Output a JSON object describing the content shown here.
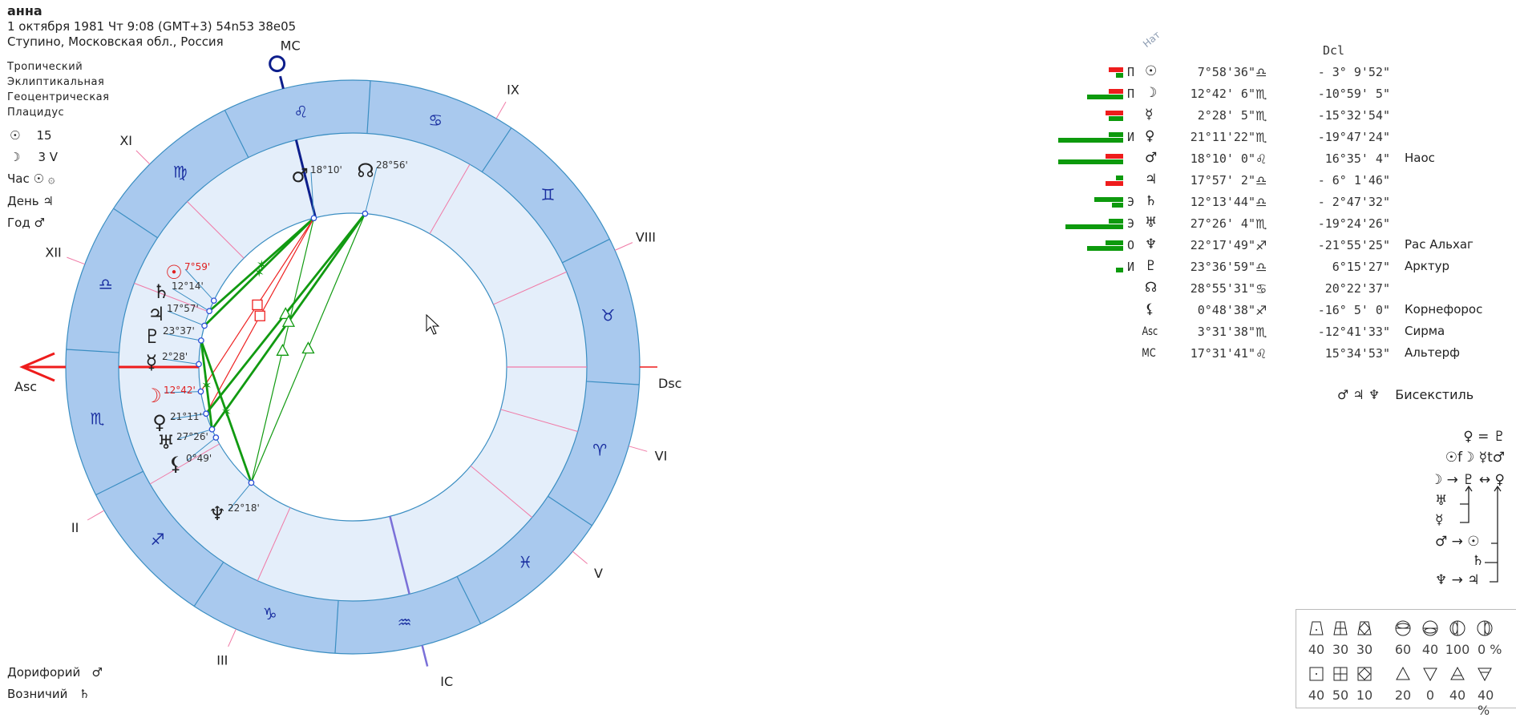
{
  "header": {
    "name": "анна",
    "datetime": "1 октября 1981  Чт   9:08 (GMT+3) 54n53  38e05",
    "place": "Ступино, Московская обл., Россия"
  },
  "settings": [
    "Тропический",
    "Эклиптикальная",
    "Геоцентрическая",
    "Плацидус"
  ],
  "left_info": {
    "sun_day": {
      "glyph": "☉",
      "value": "15"
    },
    "moon_day": {
      "glyph": "☽",
      "value": "3 V"
    },
    "hour": {
      "label": "Час",
      "glyph": "☉ ۞"
    },
    "day": {
      "label": "День",
      "glyph": "♃"
    },
    "year": {
      "label": "Год",
      "glyph": "♂"
    },
    "doryphory": {
      "label": "Дорифорий",
      "glyph": "♂"
    },
    "charioteer": {
      "label": "Возничий",
      "glyph": "♄"
    }
  },
  "wheel": {
    "asc_longitude": 213.527,
    "mc_longitude": 137.528,
    "labels": {
      "mc": "MC",
      "asc": "Asc",
      "dsc": "Dsc",
      "ic": "IC"
    },
    "colors": {
      "band": "#a9c9ee",
      "inner": "#e4eefa",
      "ring": "#3b8ec2",
      "sign": "#1a2fa0",
      "cusp": "#f07aa6",
      "asc": "#ee1c1c",
      "mc": "#0d1e8c",
      "ic": "#7a70d8",
      "marker": "#2a4fd6",
      "sextile": "#119a11",
      "trine": "#119a11",
      "square": "#ee2222"
    },
    "signs": [
      "♈",
      "♉",
      "♊",
      "♋",
      "♌",
      "♍",
      "♎",
      "♏",
      "♐",
      "♑",
      "♒",
      "♓"
    ],
    "houses": [
      {
        "label": "VIII",
        "angle_deg": 24
      },
      {
        "label": "IX",
        "angle_deg": 60
      },
      {
        "label": "XI",
        "angle_deg": 135
      },
      {
        "label": "XII",
        "angle_deg": 159
      },
      {
        "label": "II",
        "angle_deg": 210
      },
      {
        "label": "III",
        "angle_deg": 246
      },
      {
        "label": "V",
        "angle_deg": 320
      },
      {
        "label": "VI",
        "angle_deg": 344
      }
    ],
    "planets": [
      {
        "id": "sun",
        "glyph": "☉",
        "lon": 187.977,
        "label": "7°59'",
        "color": "#e02020"
      },
      {
        "id": "saturn",
        "glyph": "♄",
        "lon": 192.229,
        "label": "12°14'",
        "color": "#222"
      },
      {
        "id": "jupiter",
        "glyph": "♃",
        "lon": 197.951,
        "label": "17°57'",
        "color": "#222"
      },
      {
        "id": "pluto",
        "glyph": "♇",
        "lon": 203.616,
        "label": "23°37'",
        "color": "#222"
      },
      {
        "id": "mercury",
        "glyph": "☿",
        "lon": 212.468,
        "label": "2°28'",
        "color": "#222"
      },
      {
        "id": "moon",
        "glyph": "☽",
        "lon": 222.702,
        "label": "12°42'",
        "color": "#e02020"
      },
      {
        "id": "venus",
        "glyph": "♀",
        "lon": 231.189,
        "label": "21°11'",
        "color": "#222"
      },
      {
        "id": "uranus",
        "glyph": "♅",
        "lon": 237.434,
        "label": "27°26'",
        "color": "#222"
      },
      {
        "id": "lilith",
        "glyph": "⚸",
        "lon": 240.81,
        "label": "0°49'",
        "color": "#222"
      },
      {
        "id": "neptune",
        "glyph": "♆",
        "lon": 262.297,
        "label": "22°18'",
        "color": "#222"
      },
      {
        "id": "mars",
        "glyph": "♂",
        "lon": 138.167,
        "label": "18°10'",
        "color": "#222"
      },
      {
        "id": "node",
        "glyph": "☊",
        "lon": 118.925,
        "label": "28°56'",
        "color": "#222"
      }
    ],
    "aspects": [
      [
        "mars",
        "jupiter",
        "sextile"
      ],
      [
        "mars",
        "saturn",
        "sextile"
      ],
      [
        "mars",
        "moon",
        "square"
      ],
      [
        "mars",
        "venus",
        "square"
      ],
      [
        "mars",
        "neptune",
        "trine"
      ],
      [
        "node",
        "venus",
        "trine"
      ],
      [
        "node",
        "uranus",
        "trine"
      ],
      [
        "node",
        "neptune",
        "trine"
      ],
      [
        "pluto",
        "neptune",
        "sextile"
      ],
      [
        "pluto",
        "uranus",
        "sextile"
      ]
    ]
  },
  "table": {
    "column_nat": "Нат",
    "column_dcl": "Dcl",
    "rows": [
      {
        "bars": {
          "top": {
            "color": "red",
            "value": 18
          },
          "bottom": {
            "color": "green",
            "value": 9
          }
        },
        "status": "П",
        "glyph": "☉",
        "lon": "7°58'36\"",
        "sign": "♎",
        "dcl": "- 3° 9'52\"",
        "star": ""
      },
      {
        "bars": {
          "top": {
            "color": "red",
            "value": 18
          },
          "bottom": {
            "color": "green",
            "value": 45
          }
        },
        "status": "П",
        "glyph": "☽",
        "lon": "12°42' 6\"",
        "sign": "♏",
        "dcl": "-10°59' 5\"",
        "star": ""
      },
      {
        "bars": {
          "top": {
            "color": "red",
            "value": 22
          },
          "bottom": {
            "color": "green",
            "value": 18
          }
        },
        "status": "",
        "glyph": "☿",
        "lon": "2°28' 5\"",
        "sign": "♏",
        "dcl": "-15°32'54\"",
        "star": ""
      },
      {
        "bars": {
          "top": {
            "color": "green",
            "value": 18
          },
          "bottom": {
            "color": "green",
            "value": 81
          }
        },
        "status": "И",
        "glyph": "♀",
        "lon": "21°11'22\"",
        "sign": "♏",
        "dcl": "-19°47'24\"",
        "star": ""
      },
      {
        "bars": {
          "top": {
            "color": "red",
            "value": 22
          },
          "bottom": {
            "color": "green",
            "value": 81
          }
        },
        "status": "",
        "glyph": "♂",
        "lon": "18°10' 0\"",
        "sign": "♌",
        "dcl": "16°35' 4\"",
        "star": "Наос"
      },
      {
        "bars": {
          "top": {
            "color": "green",
            "value": 9
          },
          "bottom": {
            "color": "red",
            "value": 22
          }
        },
        "status": "",
        "glyph": "♃",
        "lon": "17°57' 2\"",
        "sign": "♎",
        "dcl": "- 6° 1'46\"",
        "star": ""
      },
      {
        "bars": {
          "top": {
            "color": "green",
            "value": 36
          },
          "bottom": {
            "color": "green",
            "value": 14
          }
        },
        "status": "Э",
        "glyph": "♄",
        "lon": "12°13'44\"",
        "sign": "♎",
        "dcl": "- 2°47'32\"",
        "star": ""
      },
      {
        "bars": {
          "top": {
            "color": "green",
            "value": 18
          },
          "bottom": {
            "color": "green",
            "value": 72
          }
        },
        "status": "Э",
        "glyph": "♅",
        "lon": "27°26' 4\"",
        "sign": "♏",
        "dcl": "-19°24'26\"",
        "star": ""
      },
      {
        "bars": {
          "top": {
            "color": "green",
            "value": 22
          },
          "bottom": {
            "color": "green",
            "value": 45
          }
        },
        "status": "О",
        "glyph": "♆",
        "lon": "22°17'49\"",
        "sign": "♐",
        "dcl": "-21°55'25\"",
        "star": "Рас Альхаг"
      },
      {
        "bars": {
          "top": {
            "color": "green",
            "value": 0
          },
          "bottom": {
            "color": "green",
            "value": 9
          }
        },
        "status": "И",
        "glyph": "♇",
        "lon": "23°36'59\"",
        "sign": "♎",
        "dcl": "6°15'27\"",
        "star": "Арктур"
      },
      {
        "bars": null,
        "status": "",
        "glyph": "☊",
        "lon": "28°55'31\"",
        "sign": "♋",
        "dcl": "20°22'37\"",
        "star": ""
      },
      {
        "bars": null,
        "status": "",
        "glyph": "⚸",
        "lon": "0°48'38\"",
        "sign": "♐",
        "dcl": "-16° 5' 0\"",
        "star": "Корнефорос"
      },
      {
        "bars": null,
        "status": "",
        "glyph": "Asc",
        "lon": "3°31'38\"",
        "sign": "♏",
        "dcl": "-12°41'33\"",
        "star": "Сирма"
      },
      {
        "bars": null,
        "status": "",
        "glyph": "MC",
        "lon": "17°31'41\"",
        "sign": "♌",
        "dcl": "15°34'53\"",
        "star": "Альтерф"
      }
    ]
  },
  "configuration": {
    "glyphs": "♂ ♃ ♆",
    "name": "Бисекстиль"
  },
  "dispositors": {
    "line1": "♀ = ♇",
    "line2": "☉f☽ ☿t♂",
    "line3": "☽ → ♇ ↔ ♀",
    "uranus": "♅",
    "mercury": "☿",
    "line_mars_sun": "♂ → ☉",
    "saturn": "♄",
    "line_nep_jup": "♆ → ♃"
  },
  "summary": {
    "row1_left": [
      "40",
      "30",
      "30"
    ],
    "row1_right": [
      "60",
      "40",
      "100",
      "0 %"
    ],
    "row2_left": [
      "40",
      "50",
      "10"
    ],
    "row2_right": [
      "20",
      "0",
      "40",
      "40 %"
    ]
  }
}
